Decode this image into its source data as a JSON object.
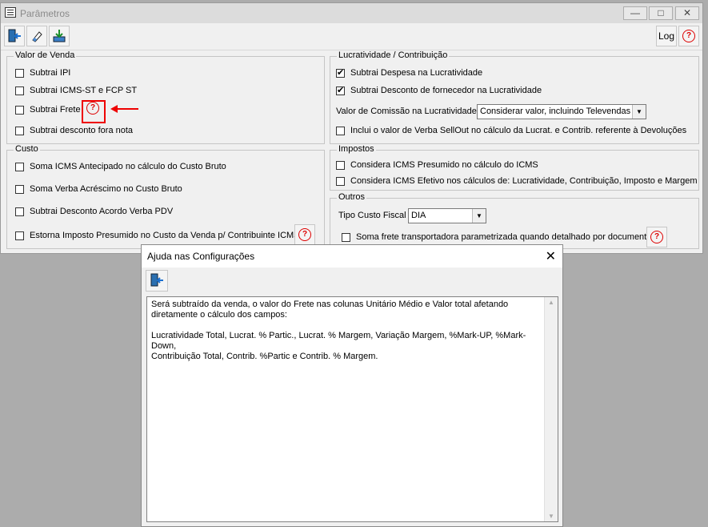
{
  "window": {
    "title": "Parâmetros",
    "minimize": "—",
    "maximize": "□",
    "close": "✕"
  },
  "toolbar": {
    "log_label": "Log",
    "help_glyph": "?"
  },
  "valor_venda": {
    "title": "Valor de Venda",
    "items": [
      {
        "label": "Subtrai IPI",
        "checked": false
      },
      {
        "label": "Subtrai ICMS-ST e FCP ST",
        "checked": false
      },
      {
        "label": "Subtrai Frete",
        "checked": false
      },
      {
        "label": "Subtrai desconto fora nota",
        "checked": false
      }
    ]
  },
  "custo": {
    "title": "Custo",
    "items": [
      {
        "label": "Soma ICMS Antecipado no cálculo do Custo Bruto",
        "checked": false
      },
      {
        "label": "Soma Verba Acréscimo no Custo Bruto",
        "checked": false
      },
      {
        "label": "Subtrai Desconto Acordo Verba PDV",
        "checked": false
      },
      {
        "label": "Estorna Imposto Presumido no Custo da Venda p/ Contribuinte ICMS",
        "checked": false
      }
    ]
  },
  "lucratividade": {
    "title": "Lucratividade / Contribuição",
    "items": [
      {
        "label": "Subtrai Despesa na Lucratividade",
        "checked": true
      },
      {
        "label": "Subtrai Desconto de fornecedor na Lucratividade",
        "checked": true
      },
      {
        "label": "Inclui o valor de Verba SellOut no cálculo da Lucrat. e Contrib. referente à Devoluções",
        "checked": false
      }
    ],
    "comissao_label": "Valor de Comissão na Lucratividade:",
    "comissao_value": "Considerar valor, incluindo Televendas"
  },
  "impostos": {
    "title": "Impostos",
    "items": [
      {
        "label": "Considera ICMS Presumido no cálculo do ICMS",
        "checked": false
      },
      {
        "label": "Considera ICMS Efetivo nos cálculos de: Lucratividade, Contribuição, Imposto e Margem",
        "checked": false
      }
    ]
  },
  "outros": {
    "title": "Outros",
    "tipo_custo_label": "Tipo Custo Fiscal",
    "tipo_custo_value": "DIA",
    "items": [
      {
        "label": "Soma frete transportadora parametrizada quando detalhado por documento",
        "checked": false
      }
    ]
  },
  "dialog": {
    "title": "Ajuda nas Configurações",
    "close": "✕",
    "text": "Será subtraído da venda, o valor do Frete nas colunas Unitário Médio e Valor total afetando\ndiretamente o cálculo dos campos:\n\nLucratividade Total, Lucrat. % Partic., Lucrat. % Margem, Variação Margem, %Mark-UP, %Mark-Down,\nContribuição Total, Contrib. %Partic e Contrib. % Margem."
  },
  "colors": {
    "highlight": "#e00000",
    "help_icon": "#d00000"
  }
}
